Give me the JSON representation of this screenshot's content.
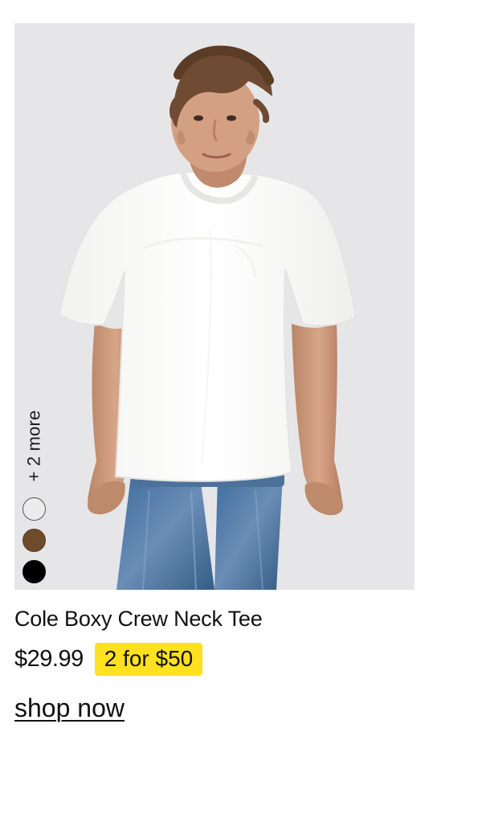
{
  "product": {
    "name": "Cole Boxy Crew Neck Tee",
    "price": "$29.99",
    "promo": "2 for $50",
    "more_colors": "+ 2 more",
    "cta": "shop now",
    "image_icon": "model-wearing-white-tee-icon"
  },
  "swatches": [
    {
      "name": "white",
      "color": "#ececec"
    },
    {
      "name": "brown",
      "color": "#6d4c2b"
    },
    {
      "name": "black",
      "color": "#000000"
    }
  ],
  "colors": {
    "background": "#ffffff",
    "image_background": "#e6e6e8",
    "promo_background": "#ffe11f",
    "text": "#111111"
  }
}
